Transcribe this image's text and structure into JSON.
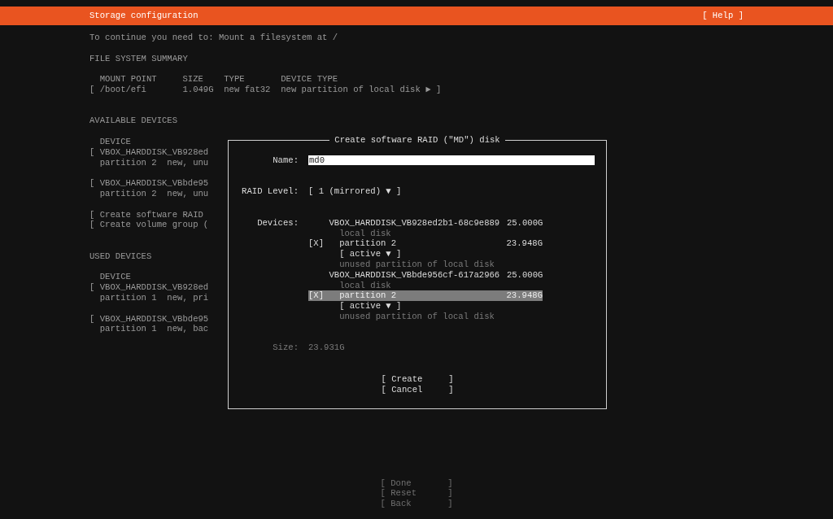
{
  "header": {
    "title": "Storage configuration",
    "help": "[ Help ]"
  },
  "message": "To continue you need to: Mount a filesystem at /",
  "fs_summary": {
    "title": "FILE SYSTEM SUMMARY",
    "columns": [
      "MOUNT POINT",
      "SIZE",
      "TYPE",
      "DEVICE TYPE"
    ],
    "rows": [
      {
        "cells": [
          "[ /boot/efi",
          "1.049G",
          "new fat32",
          "new partition of local disk ► ]"
        ]
      }
    ]
  },
  "available_devices": {
    "title": "AVAILABLE DEVICES",
    "column": "DEVICE",
    "groups": [
      {
        "lines": [
          {
            "kind": "disk",
            "text": "[ VBOX_HARDDISK_VB928ed"
          },
          {
            "kind": "partition",
            "text": "partition 2  new, unu"
          }
        ]
      },
      {
        "lines": [
          {
            "kind": "disk",
            "text": "[ VBOX_HARDDISK_VBbde95"
          },
          {
            "kind": "partition",
            "text": "partition 2  new, unu"
          }
        ]
      },
      {
        "lines": [
          {
            "kind": "action",
            "text": "[ Create software RAID"
          },
          {
            "kind": "action",
            "text": "[ Create volume group ("
          }
        ]
      }
    ]
  },
  "used_devices": {
    "title": "USED DEVICES",
    "column": "DEVICE",
    "groups": [
      {
        "lines": [
          {
            "kind": "disk",
            "text": "[ VBOX_HARDDISK_VB928ed"
          },
          {
            "kind": "partition",
            "text": "partition 1  new, pri"
          }
        ]
      },
      {
        "lines": [
          {
            "kind": "disk",
            "text": "[ VBOX_HARDDISK_VBbde95"
          },
          {
            "kind": "partition",
            "text": "partition 1  new, bac"
          }
        ]
      }
    ]
  },
  "footer_buttons": [
    "[ Done       ]",
    "[ Reset      ]",
    "[ Back       ]"
  ],
  "dialog": {
    "title": "Create software RAID (\"MD\") disk",
    "name": {
      "label": "Name:",
      "value": "md0"
    },
    "raid_level": {
      "label": "RAID Level:",
      "value": "[ 1 (mirrored) ▼ ]"
    },
    "devices": {
      "label": "Devices:",
      "items": [
        {
          "kind": "disk",
          "name": "VBOX_HARDDISK_VB928ed2b1-68c9e889",
          "size": "25.000G",
          "note": "local disk"
        },
        {
          "kind": "partition",
          "checkbox": "[X]",
          "checked": true,
          "selected": false,
          "name": "partition 2",
          "size": "23.948G",
          "format": "[ active ▼ ]",
          "note": "unused partition of local disk"
        },
        {
          "kind": "disk",
          "name": "VBOX_HARDDISK_VBbde956cf-617a2966",
          "size": "25.000G",
          "note": "local disk"
        },
        {
          "kind": "partition",
          "checkbox": "[X]",
          "checked": true,
          "selected": true,
          "name": "partition 2",
          "size": "23.948G",
          "format": "[ active ▼ ]",
          "note": "unused partition of local disk"
        }
      ]
    },
    "size": {
      "label": "Size:",
      "value": "23.931G"
    },
    "buttons": [
      "[ Create     ]",
      "[ Cancel     ]"
    ]
  }
}
